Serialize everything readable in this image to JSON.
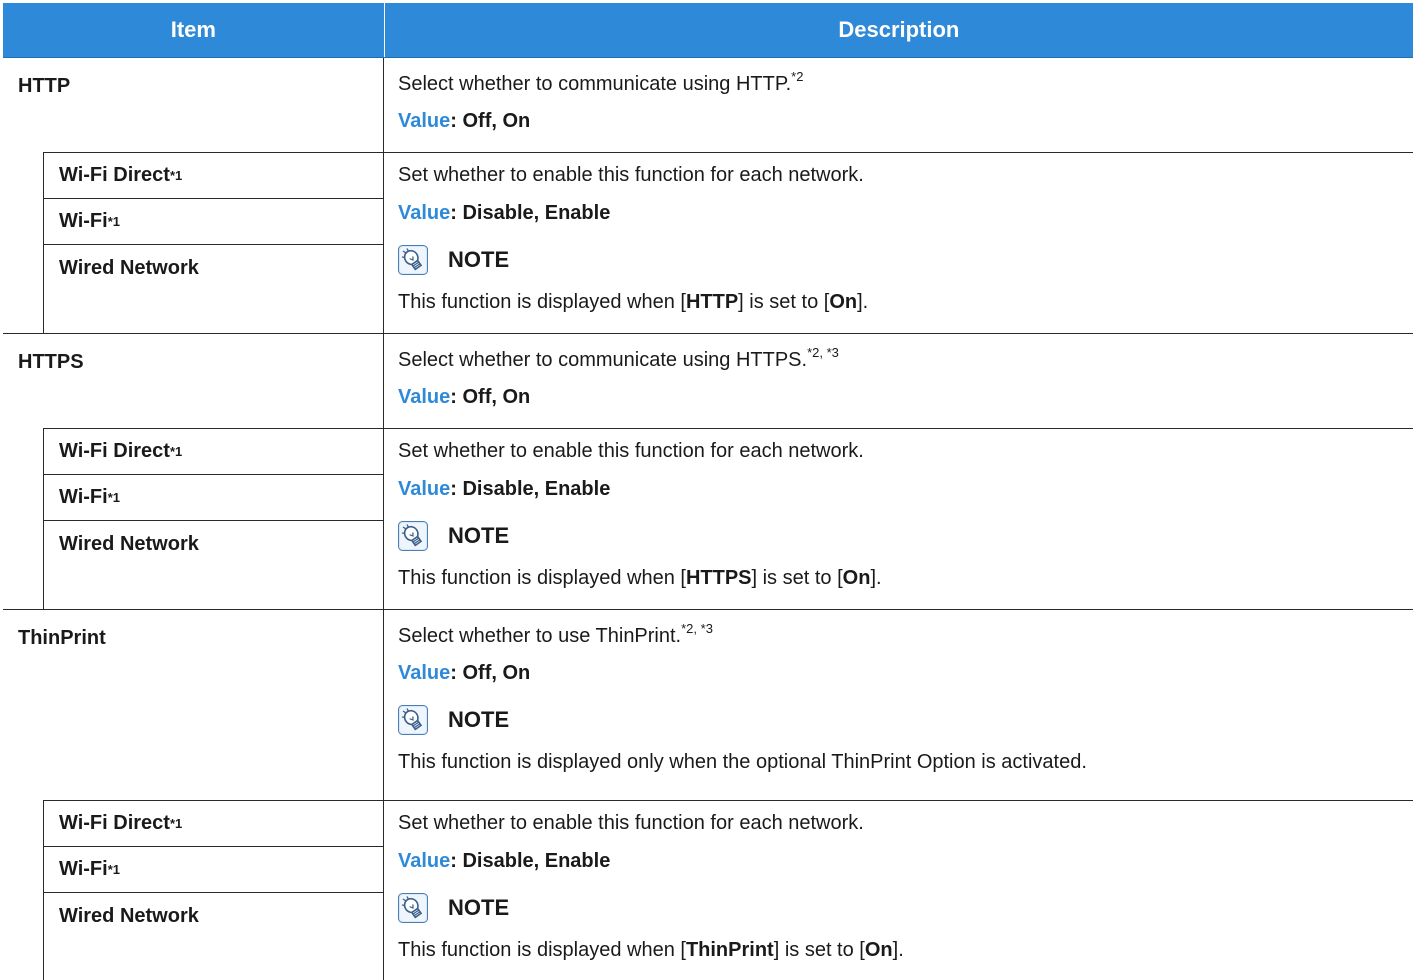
{
  "header": {
    "item": "Item",
    "description": "Description"
  },
  "colors": {
    "header_background": "#2e8ad8",
    "value_accent": "#2e8ad8"
  },
  "http": {
    "label": "HTTP",
    "description": "Select whether to communicate using HTTP.",
    "description_sup": "*2",
    "value_key": "Value",
    "value_options": ": Off, On",
    "sub_items": [
      {
        "label": "Wi-Fi Direct",
        "sup": "*1"
      },
      {
        "label": "Wi-Fi",
        "sup": "*1"
      },
      {
        "label": "Wired Network",
        "sup": ""
      }
    ],
    "sub_description": "Set whether to enable this function for each network.",
    "sub_value_key": "Value",
    "sub_value_options": ": Disable, Enable",
    "note_icon": "note-lightbulb-icon",
    "note_label": "NOTE",
    "note_text_1": "This function is displayed when [",
    "note_bold_1": "HTTP",
    "note_text_2": "] is set to [",
    "note_bold_2": "On",
    "note_text_3": "]."
  },
  "https": {
    "label": "HTTPS",
    "description": "Select whether to communicate using HTTPS.",
    "description_sup": "*2, *3",
    "value_key": "Value",
    "value_options": ": Off, On",
    "sub_items": [
      {
        "label": "Wi-Fi Direct",
        "sup": "*1"
      },
      {
        "label": "Wi-Fi",
        "sup": "*1"
      },
      {
        "label": "Wired Network",
        "sup": ""
      }
    ],
    "sub_description": "Set whether to enable this function for each network.",
    "sub_value_key": "Value",
    "sub_value_options": ": Disable, Enable",
    "note_icon": "note-lightbulb-icon",
    "note_label": "NOTE",
    "note_text_1": "This function is displayed when [",
    "note_bold_1": "HTTPS",
    "note_text_2": "] is set to [",
    "note_bold_2": "On",
    "note_text_3": "]."
  },
  "thinprint": {
    "label": "ThinPrint",
    "description": "Select whether to use ThinPrint.",
    "description_sup": "*2, *3",
    "value_key": "Value",
    "value_options": ": Off, On",
    "top_note_icon": "note-lightbulb-icon",
    "top_note_label": "NOTE",
    "top_note_text": "This function is displayed only when the optional ThinPrint Option is activated.",
    "sub_items": [
      {
        "label": "Wi-Fi Direct",
        "sup": "*1"
      },
      {
        "label": "Wi-Fi",
        "sup": "*1"
      },
      {
        "label": "Wired Network",
        "sup": ""
      }
    ],
    "sub_description": "Set whether to enable this function for each network.",
    "sub_value_key": "Value",
    "sub_value_options": ": Disable, Enable",
    "note_icon": "note-lightbulb-icon",
    "note_label": "NOTE",
    "note_text_1": "This function is displayed when [",
    "note_bold_1": "ThinPrint",
    "note_text_2": "] is set to [",
    "note_bold_2": "On",
    "note_text_3": "]."
  }
}
